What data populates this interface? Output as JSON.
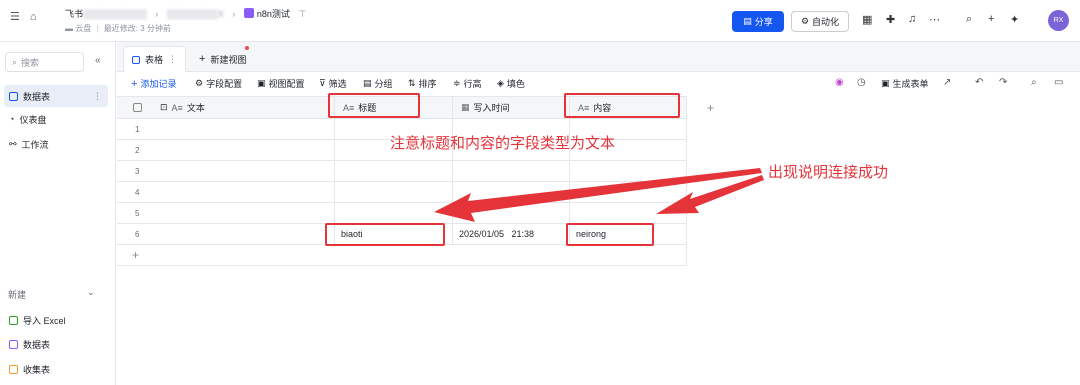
{
  "topbar": {
    "breadcrumb_root": "飞书",
    "breadcrumb_blur1": "▒▒▒▒▒▒▒▒▒▒",
    "breadcrumb_blur2": "▒▒▒▒▒▒▒▒X",
    "title": "n8n测试",
    "meta_location": "云盘",
    "meta_modified": "最近修改: 3 分钟前",
    "share_label": "分享",
    "automate_label": "自动化",
    "avatar_initials": "RX"
  },
  "sidebar": {
    "search_placeholder": "搜索",
    "items": [
      {
        "label": "数据表",
        "icon": "table-icon"
      },
      {
        "label": "仪表盘",
        "icon": "dashboard-icon"
      },
      {
        "label": "工作流",
        "icon": "workflow-icon"
      }
    ],
    "new_section_label": "新建",
    "new_items": [
      {
        "label": "导入 Excel",
        "icon": "excel-icon"
      },
      {
        "label": "数据表",
        "icon": "table-icon"
      },
      {
        "label": "收集表",
        "icon": "form-icon"
      }
    ]
  },
  "tabs": {
    "active": "表格",
    "new_view": "新建视图"
  },
  "toolbar": {
    "add_record": "添加记录",
    "field_config": "字段配置",
    "view_config": "视图配置",
    "filter": "筛选",
    "group": "分组",
    "sort": "排序",
    "row_height": "行高",
    "fill_color": "填色",
    "generate_form": "生成表单"
  },
  "grid": {
    "columns": [
      {
        "label": "文本",
        "type_icon": "text-field-icon"
      },
      {
        "label": "标题",
        "type_icon": "text-field-icon"
      },
      {
        "label": "写入时间",
        "type_icon": "datetime-field-icon"
      },
      {
        "label": "内容",
        "type_icon": "text-field-icon"
      }
    ],
    "row_numbers": [
      "1",
      "2",
      "3",
      "4",
      "5",
      "6"
    ],
    "row6": {
      "title": "biaoti",
      "time": "2026/01/05   21:38",
      "content": "neirong"
    }
  },
  "annotations": {
    "field_type_note": "注意标题和内容的字段类型为文本",
    "success_note": "出现说明连接成功"
  },
  "colors": {
    "accent": "#1456f0",
    "annotation_red": "#e4343a"
  }
}
